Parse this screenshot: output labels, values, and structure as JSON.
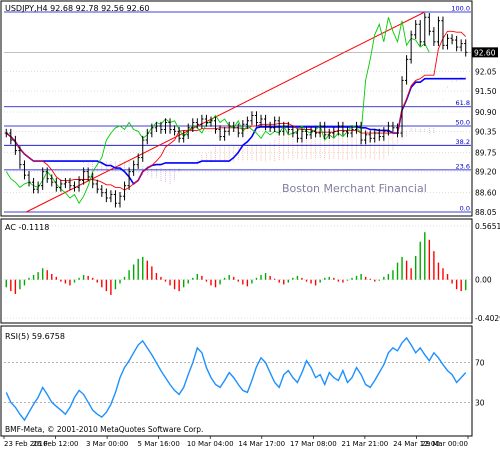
{
  "colors": {
    "background": "#ffffff",
    "border": "#000000",
    "grid": "#c0c0c0",
    "bull_bar": "#000000",
    "bear_bar": "#000000",
    "kijun": "#0000ff",
    "tenkan": "#ff0000",
    "chikou": "#00cc00",
    "cloud_up": "#f4b39a",
    "cloud_down": "#c8a8d0",
    "fib_line": "#0000cc",
    "trend_line": "#ff0000",
    "ac_up": "#00aa00",
    "ac_down": "#ff0000",
    "rsi": "#1e90ff",
    "rsi_level": "#888888",
    "watermark": "#8080a0",
    "price_tag_bg": "#000000",
    "price_tag_fg": "#ffffff"
  },
  "header": {
    "main_label": "USDJPY,H4  92.68  92.78  92.56  92.60",
    "ac_label": "AC -0.1118",
    "rsi_label": "RSI(5) 59.6758",
    "watermark": "Boston Merchant Financial",
    "copyright": "BMF-Meta, © 2001-2010 MetaQuotes Software Corp.",
    "current_price": "92.60"
  },
  "chart_data": [
    {
      "type": "candlestick",
      "title": "USDJPY,H4",
      "ohlc_last": {
        "open": 92.68,
        "high": 92.78,
        "low": 92.56,
        "close": 92.6
      },
      "ylim": [
        88.05,
        93.75
      ],
      "price_ticks": [
        "92.05",
        "91.50",
        "90.90",
        "90.35",
        "89.75",
        "89.20",
        "88.60",
        "88.05"
      ],
      "fib_levels": [
        {
          "label": "100.0",
          "price": 93.75
        },
        {
          "label": "61.8",
          "price": 91.05
        },
        {
          "label": "50.0",
          "price": 90.5
        },
        {
          "label": "38.2",
          "price": 89.95
        },
        {
          "label": "23.6",
          "price": 89.25
        },
        {
          "label": "0.0",
          "price": 88.05
        }
      ],
      "x_ticks": [
        "23 Feb 2010",
        "26 Feb 12:00",
        "3 Mar 00:00",
        "5 Mar 16:00",
        "10 Mar 04:00",
        "14 Mar 17:00",
        "17 Mar 08:00",
        "21 Mar 21:00",
        "24 Mar 12:00",
        "29 Mar 00:00"
      ],
      "close": [
        90.3,
        90.1,
        89.8,
        89.4,
        89.1,
        88.9,
        88.7,
        88.8,
        89.2,
        89.0,
        88.9,
        88.75,
        88.85,
        88.9,
        88.8,
        88.75,
        88.95,
        89.2,
        89.05,
        88.85,
        88.7,
        88.6,
        88.45,
        88.55,
        88.3,
        88.5,
        88.8,
        89.2,
        89.4,
        89.6,
        90.1,
        90.3,
        90.45,
        90.5,
        90.4,
        90.6,
        90.4,
        90.35,
        90.15,
        90.25,
        90.45,
        90.6,
        90.55,
        90.7,
        90.6,
        90.65,
        90.4,
        90.2,
        90.35,
        90.5,
        90.45,
        90.3,
        90.55,
        90.65,
        90.8,
        90.6,
        90.7,
        90.5,
        90.45,
        90.65,
        90.35,
        90.5,
        90.4,
        90.3,
        90.15,
        90.35,
        90.25,
        90.35,
        90.3,
        90.5,
        90.25,
        90.3,
        90.35,
        90.5,
        90.35,
        90.3,
        90.4,
        90.5,
        90.1,
        90.25,
        90.15,
        90.3,
        90.2,
        90.35,
        90.5,
        90.45,
        90.3,
        91.8,
        92.4,
        93.1,
        93.4,
        92.9,
        93.6,
        93.2,
        92.9,
        93.5,
        92.8,
        93.0,
        92.95,
        92.75,
        92.85,
        92.6
      ]
    },
    {
      "type": "bar",
      "title": "AC",
      "last_value": -0.1118,
      "ylim": [
        -0.4029,
        0.5651
      ],
      "y_ticks": [
        "0.5651",
        "0.00",
        "-0.4029"
      ],
      "values": [
        -0.08,
        -0.12,
        -0.15,
        -0.1,
        -0.06,
        0.02,
        0.05,
        0.08,
        0.12,
        0.1,
        0.06,
        0.03,
        -0.02,
        -0.04,
        -0.06,
        -0.03,
        0.02,
        0.05,
        0.04,
        0.02,
        -0.03,
        -0.08,
        -0.12,
        -0.16,
        -0.1,
        -0.04,
        0.03,
        0.1,
        0.16,
        0.22,
        0.24,
        0.2,
        0.14,
        0.07,
        0.03,
        -0.02,
        -0.06,
        -0.1,
        -0.12,
        -0.08,
        -0.04,
        0.02,
        0.06,
        0.04,
        -0.02,
        -0.06,
        -0.08,
        -0.05,
        0.02,
        0.05,
        0.03,
        -0.02,
        -0.05,
        -0.07,
        -0.04,
        0.02,
        0.05,
        0.07,
        0.04,
        0.01,
        -0.03,
        -0.05,
        -0.03,
        0.02,
        0.04,
        0.02,
        -0.02,
        -0.04,
        -0.06,
        -0.03,
        0.02,
        0.03,
        0.02,
        -0.02,
        -0.03,
        -0.01,
        0.02,
        0.04,
        0.06,
        0.03,
        0.01,
        -0.02,
        -0.01,
        0.03,
        0.06,
        0.1,
        0.18,
        0.24,
        0.2,
        0.12,
        0.25,
        0.4,
        0.5,
        0.42,
        0.3,
        0.18,
        0.12,
        0.06,
        -0.04,
        -0.1,
        -0.12,
        -0.11
      ]
    },
    {
      "type": "line",
      "title": "RSI(5)",
      "last_value": 59.6758,
      "ylim": [
        0,
        100
      ],
      "levels": [
        70,
        30
      ],
      "y_ticks": [
        "70",
        "30"
      ],
      "values": [
        40,
        30,
        25,
        18,
        12,
        20,
        28,
        35,
        45,
        38,
        30,
        26,
        22,
        18,
        25,
        35,
        42,
        38,
        30,
        22,
        18,
        15,
        20,
        28,
        40,
        55,
        65,
        72,
        80,
        88,
        92,
        85,
        78,
        70,
        62,
        55,
        48,
        42,
        38,
        45,
        58,
        70,
        85,
        80,
        65,
        55,
        48,
        45,
        52,
        60,
        55,
        48,
        42,
        40,
        52,
        66,
        75,
        70,
        60,
        50,
        45,
        58,
        62,
        55,
        50,
        60,
        72,
        65,
        55,
        58,
        48,
        60,
        55,
        52,
        62,
        50,
        55,
        65,
        58,
        48,
        45,
        52,
        60,
        68,
        80,
        85,
        82,
        90,
        95,
        88,
        80,
        85,
        78,
        72,
        80,
        75,
        68,
        62,
        58,
        50,
        55,
        60
      ]
    }
  ]
}
